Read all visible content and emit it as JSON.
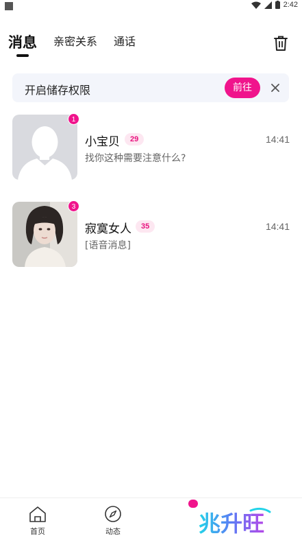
{
  "status_bar": {
    "time": "2:42"
  },
  "tabs": [
    {
      "label": "消息",
      "active": true
    },
    {
      "label": "亲密关系",
      "active": false
    },
    {
      "label": "通话",
      "active": false
    }
  ],
  "banner": {
    "text": "开启储存权限",
    "button": "前往"
  },
  "conversations": [
    {
      "name": "小宝贝",
      "age": "29",
      "time": "14:41",
      "message": "找你这种需要注意什么?",
      "unread": "1",
      "avatar": "default-avatar"
    },
    {
      "name": "寂寞女人",
      "age": "35",
      "time": "14:41",
      "message": "[语音消息]",
      "unread": "3",
      "avatar": "photo-avatar"
    }
  ],
  "bottom_nav": [
    {
      "label": "首页",
      "icon": "home-icon"
    },
    {
      "label": "动态",
      "icon": "compass-icon"
    }
  ],
  "watermark": "兆升旺",
  "colors": {
    "accent": "#f0148c",
    "banner_bg": "#f3f5fb",
    "age_bg": "#fde7f1"
  }
}
